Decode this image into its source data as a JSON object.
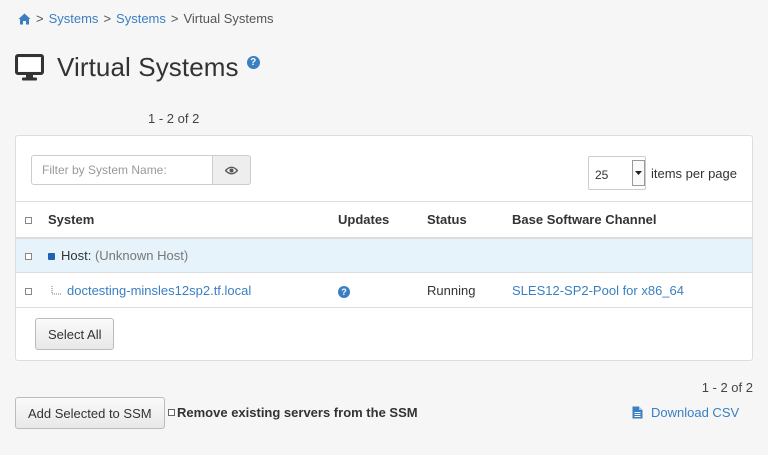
{
  "breadcrumb": {
    "items": [
      "Systems",
      "Systems"
    ],
    "current": "Virtual Systems",
    "separator": ">"
  },
  "page": {
    "title": "Virtual Systems",
    "help_glyph": "?"
  },
  "pagination": {
    "top_summary": "1 - 2 of 2",
    "bottom_summary": "1 - 2 of 2"
  },
  "filter": {
    "placeholder": "Filter by System Name:"
  },
  "per_page": {
    "value": "25",
    "label": "items per page"
  },
  "table": {
    "columns": [
      "System",
      "Updates",
      "Status",
      "Base Software Channel"
    ],
    "host_row": {
      "label": "Host:",
      "value": "(Unknown Host)"
    },
    "rows": [
      {
        "system": "doctesting-minsles12sp2.tf.local",
        "updates_glyph": "?",
        "status": "Running",
        "channel": "SLES12-SP2-Pool for x86_64"
      }
    ]
  },
  "buttons": {
    "select_all": "Select All",
    "add_selected_ssm": "Add Selected to SSM",
    "remove_existing_label": "Remove existing servers from the SSM",
    "download_csv": "Download CSV"
  },
  "colors": {
    "link": "#3a7fc2",
    "host_row_bg": "#e6f3fb",
    "background": "#f6f6f6"
  }
}
